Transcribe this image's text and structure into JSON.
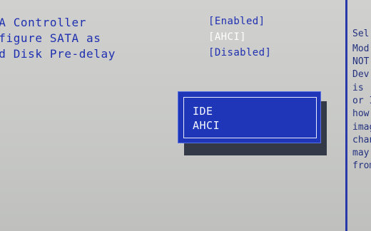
{
  "settings": [
    {
      "label": "IA Controller",
      "value": "[Enabled]",
      "selected": false
    },
    {
      "label": "nfigure SATA as",
      "value": "[AHCI]",
      "selected": true
    },
    {
      "label": "rd Disk Pre-delay",
      "value": "[Disabled]",
      "selected": false
    }
  ],
  "help_lines": [
    "Sel",
    "Mod",
    "NOT",
    "Dev",
    "is",
    "or I",
    "how",
    "imag",
    "chan",
    "may",
    "from"
  ],
  "popup": {
    "options": [
      "IDE",
      "AHCI"
    ]
  },
  "colors": {
    "background": "#c8c9c7",
    "text": "#1e2fb0",
    "popup_bg": "#1f36b8",
    "popup_text": "#f4f6ff"
  }
}
